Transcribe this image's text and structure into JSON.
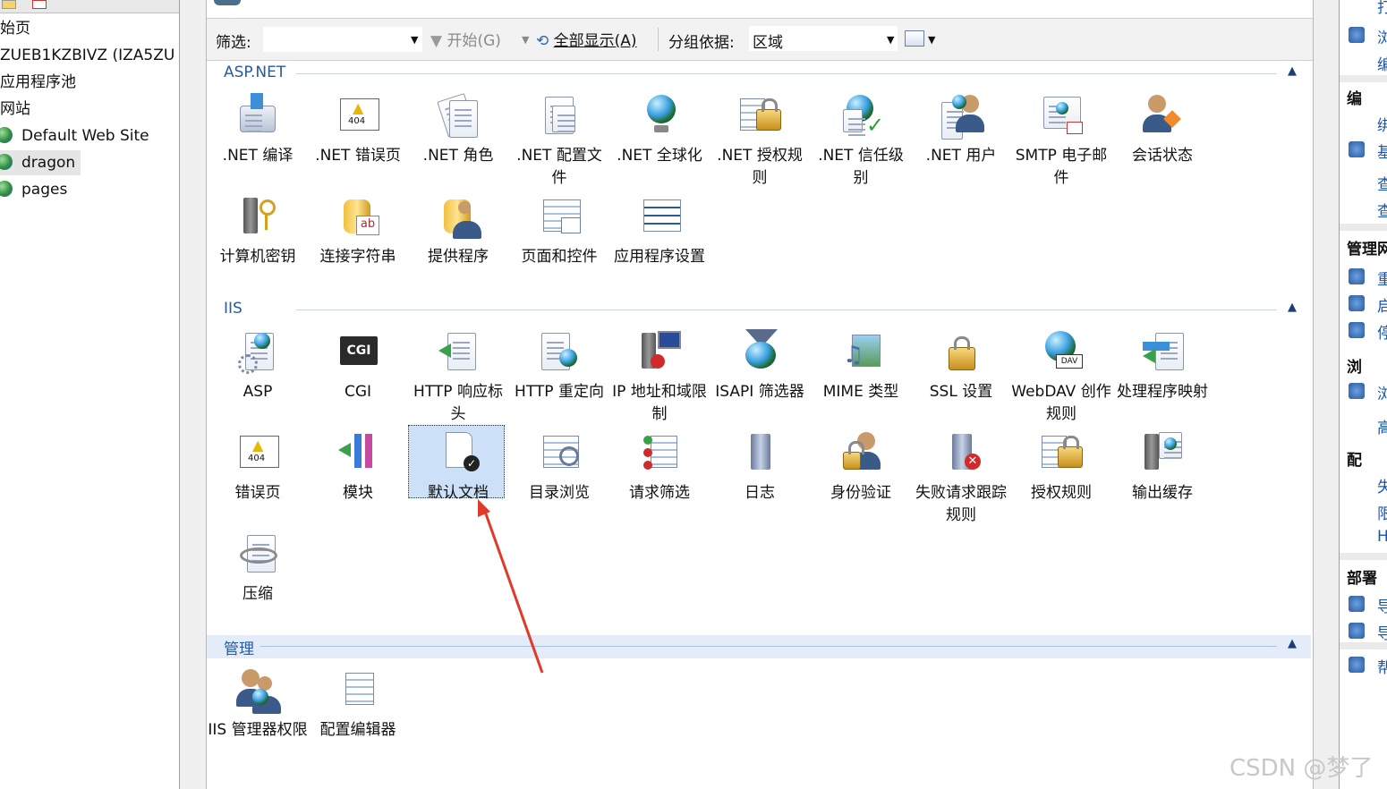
{
  "tree": {
    "nodes": [
      {
        "label": "始页"
      },
      {
        "label": "ZUEB1KZBIVZ (IZA5ZU"
      },
      {
        "label": "应用程序池"
      },
      {
        "label": "网站"
      },
      {
        "label": "Default Web Site"
      },
      {
        "label": "dragon"
      },
      {
        "label": "pages"
      }
    ]
  },
  "filterbar": {
    "filter_label": "筛选:",
    "start_label": "开始(G)",
    "show_all_label": "全部显示(A)",
    "group_by_label": "分组依据:",
    "group_value": "区域"
  },
  "sections": [
    {
      "title": "ASP.NET",
      "features": [
        {
          "label": ".NET 编译",
          "icon": "compile-icon"
        },
        {
          "label": ".NET 错误页",
          "icon": "error-404-icon"
        },
        {
          "label": ".NET 角色",
          "icon": "roles-icon"
        },
        {
          "label": ".NET 配置文件",
          "icon": "profile-icon"
        },
        {
          "label": ".NET 全球化",
          "icon": "globe-icon"
        },
        {
          "label": ".NET 授权规则",
          "icon": "lock-icon"
        },
        {
          "label": ".NET 信任级别",
          "icon": "trust-icon"
        },
        {
          "label": ".NET 用户",
          "icon": "users-icon"
        },
        {
          "label": "SMTP 电子邮件",
          "icon": "smtp-icon"
        },
        {
          "label": "会话状态",
          "icon": "session-icon"
        },
        {
          "label": "计算机密钥",
          "icon": "key-icon"
        },
        {
          "label": "连接字符串",
          "icon": "database-icon"
        },
        {
          "label": "提供程序",
          "icon": "provider-icon"
        },
        {
          "label": "页面和控件",
          "icon": "pages-controls-icon"
        },
        {
          "label": "应用程序设置",
          "icon": "app-settings-icon"
        }
      ]
    },
    {
      "title": "IIS",
      "features": [
        {
          "label": "ASP",
          "icon": "asp-icon"
        },
        {
          "label": "CGI",
          "icon": "cgi-icon"
        },
        {
          "label": "HTTP 响应标头",
          "icon": "http-headers-icon"
        },
        {
          "label": "HTTP 重定向",
          "icon": "http-redirect-icon"
        },
        {
          "label": "IP 地址和域限制",
          "icon": "ip-restrict-icon"
        },
        {
          "label": "ISAPI 筛选器",
          "icon": "isapi-filter-icon"
        },
        {
          "label": "MIME 类型",
          "icon": "mime-icon"
        },
        {
          "label": "SSL 设置",
          "icon": "ssl-lock-icon"
        },
        {
          "label": "WebDAV 创作规则",
          "icon": "webdav-icon"
        },
        {
          "label": "处理程序映射",
          "icon": "handler-icon"
        },
        {
          "label": "错误页",
          "icon": "error-page-icon"
        },
        {
          "label": "模块",
          "icon": "modules-icon"
        },
        {
          "label": "默认文档",
          "icon": "default-document-icon",
          "selected": true
        },
        {
          "label": "目录浏览",
          "icon": "directory-browse-icon"
        },
        {
          "label": "请求筛选",
          "icon": "request-filter-icon"
        },
        {
          "label": "日志",
          "icon": "log-icon"
        },
        {
          "label": "身份验证",
          "icon": "auth-icon"
        },
        {
          "label": "失败请求跟踪规则",
          "icon": "failed-request-icon"
        },
        {
          "label": "授权规则",
          "icon": "authz-icon"
        },
        {
          "label": "输出缓存",
          "icon": "output-cache-icon"
        },
        {
          "label": "压缩",
          "icon": "compression-icon"
        }
      ]
    },
    {
      "title": "管理",
      "features": [
        {
          "label": "IIS 管理器权限",
          "icon": "manager-perm-icon"
        },
        {
          "label": "配置编辑器",
          "icon": "config-editor-icon"
        }
      ]
    }
  ],
  "actions": {
    "headings": [
      "编",
      "管理网",
      "浏",
      "配",
      "部署"
    ],
    "links": [
      "打",
      "浏",
      "编",
      "绑",
      "基",
      "查",
      "查",
      "重",
      "启",
      "停",
      "浏",
      "高",
      "失",
      "限",
      "H",
      "导",
      "导",
      "帮"
    ]
  },
  "watermark": "CSDN @梦了"
}
